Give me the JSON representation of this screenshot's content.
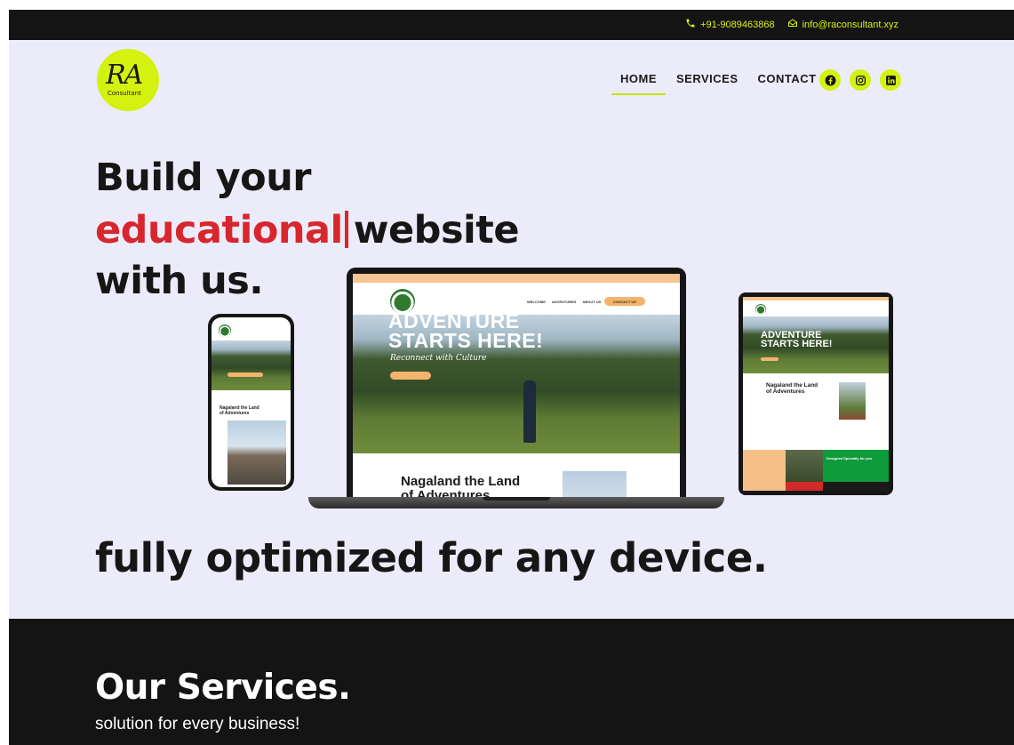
{
  "topbar": {
    "phone": "+91-9089463868",
    "email": "info@raconsultant.xyz",
    "phone_icon": "phone-icon",
    "email_icon": "envelope-icon"
  },
  "brand": {
    "logo_text": "RA",
    "logo_sub": "Consultant",
    "accent_color": "#d4f20f",
    "highlight_color": "#d7262c"
  },
  "nav": {
    "items": [
      "HOME",
      "SERVICES",
      "CONTACT"
    ],
    "active": "HOME",
    "social": [
      "facebook-icon",
      "instagram-icon",
      "linkedin-icon"
    ]
  },
  "hero": {
    "line1": "Build your",
    "highlight": "educational",
    "line2_rest": "website",
    "line3": "with us.",
    "bottom": "fully optimized for any device."
  },
  "mockup": {
    "hero_title_1": "ADVENTURE",
    "hero_title_2": "STARTS HERE!",
    "hero_sub": "Reconnect with Culture",
    "section_title_1": "Nagaland the Land",
    "section_title_2": "of Adventures",
    "nav_items": [
      "WELCOME",
      "ADVENTURES",
      "ABOUT US"
    ],
    "cta": "CONTACT US",
    "tablet_card": "Designed Specially for you"
  },
  "services": {
    "title": "Our Services.",
    "subtitle": "solution for every business!"
  }
}
